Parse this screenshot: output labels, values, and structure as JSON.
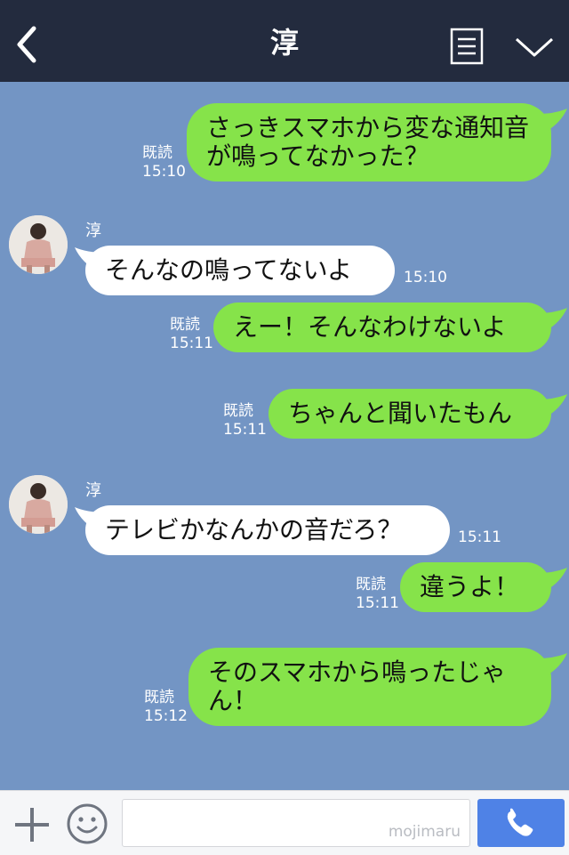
{
  "header": {
    "title": "淳"
  },
  "colors": {
    "sent_bubble": "#86e34a",
    "received_bubble": "#ffffff",
    "chat_background": "#7395c4",
    "header_background": "#232b3e",
    "call_button": "#4f82e6"
  },
  "messages": [
    {
      "side": "sent",
      "text": "さっきスマホから変な通知音が鳴ってなかった？",
      "read": "既読",
      "time": "15:10"
    },
    {
      "side": "received",
      "sender": "淳",
      "text": "そんなの鳴ってないよ",
      "time": "15:10"
    },
    {
      "side": "sent",
      "text": "えー！そんなわけないよ",
      "read": "既読",
      "time": "15:11"
    },
    {
      "side": "sent",
      "text": "ちゃんと聞いたもん",
      "read": "既読",
      "time": "15:11"
    },
    {
      "side": "received",
      "sender": "淳",
      "text": "テレビかなんかの音だろ？",
      "time": "15:11"
    },
    {
      "side": "sent",
      "text": "違うよ！",
      "read": "既読",
      "time": "15:11"
    },
    {
      "side": "sent",
      "text": "そのスマホから鳴ったじゃん！",
      "read": "既読",
      "time": "15:12"
    }
  ],
  "input": {
    "watermark": "mojimaru"
  },
  "icons": {
    "back": "back-icon",
    "menu": "menu-icon",
    "collapse": "chevron-down-icon",
    "add": "plus-icon",
    "emoji": "emoji-icon",
    "call": "phone-icon"
  }
}
